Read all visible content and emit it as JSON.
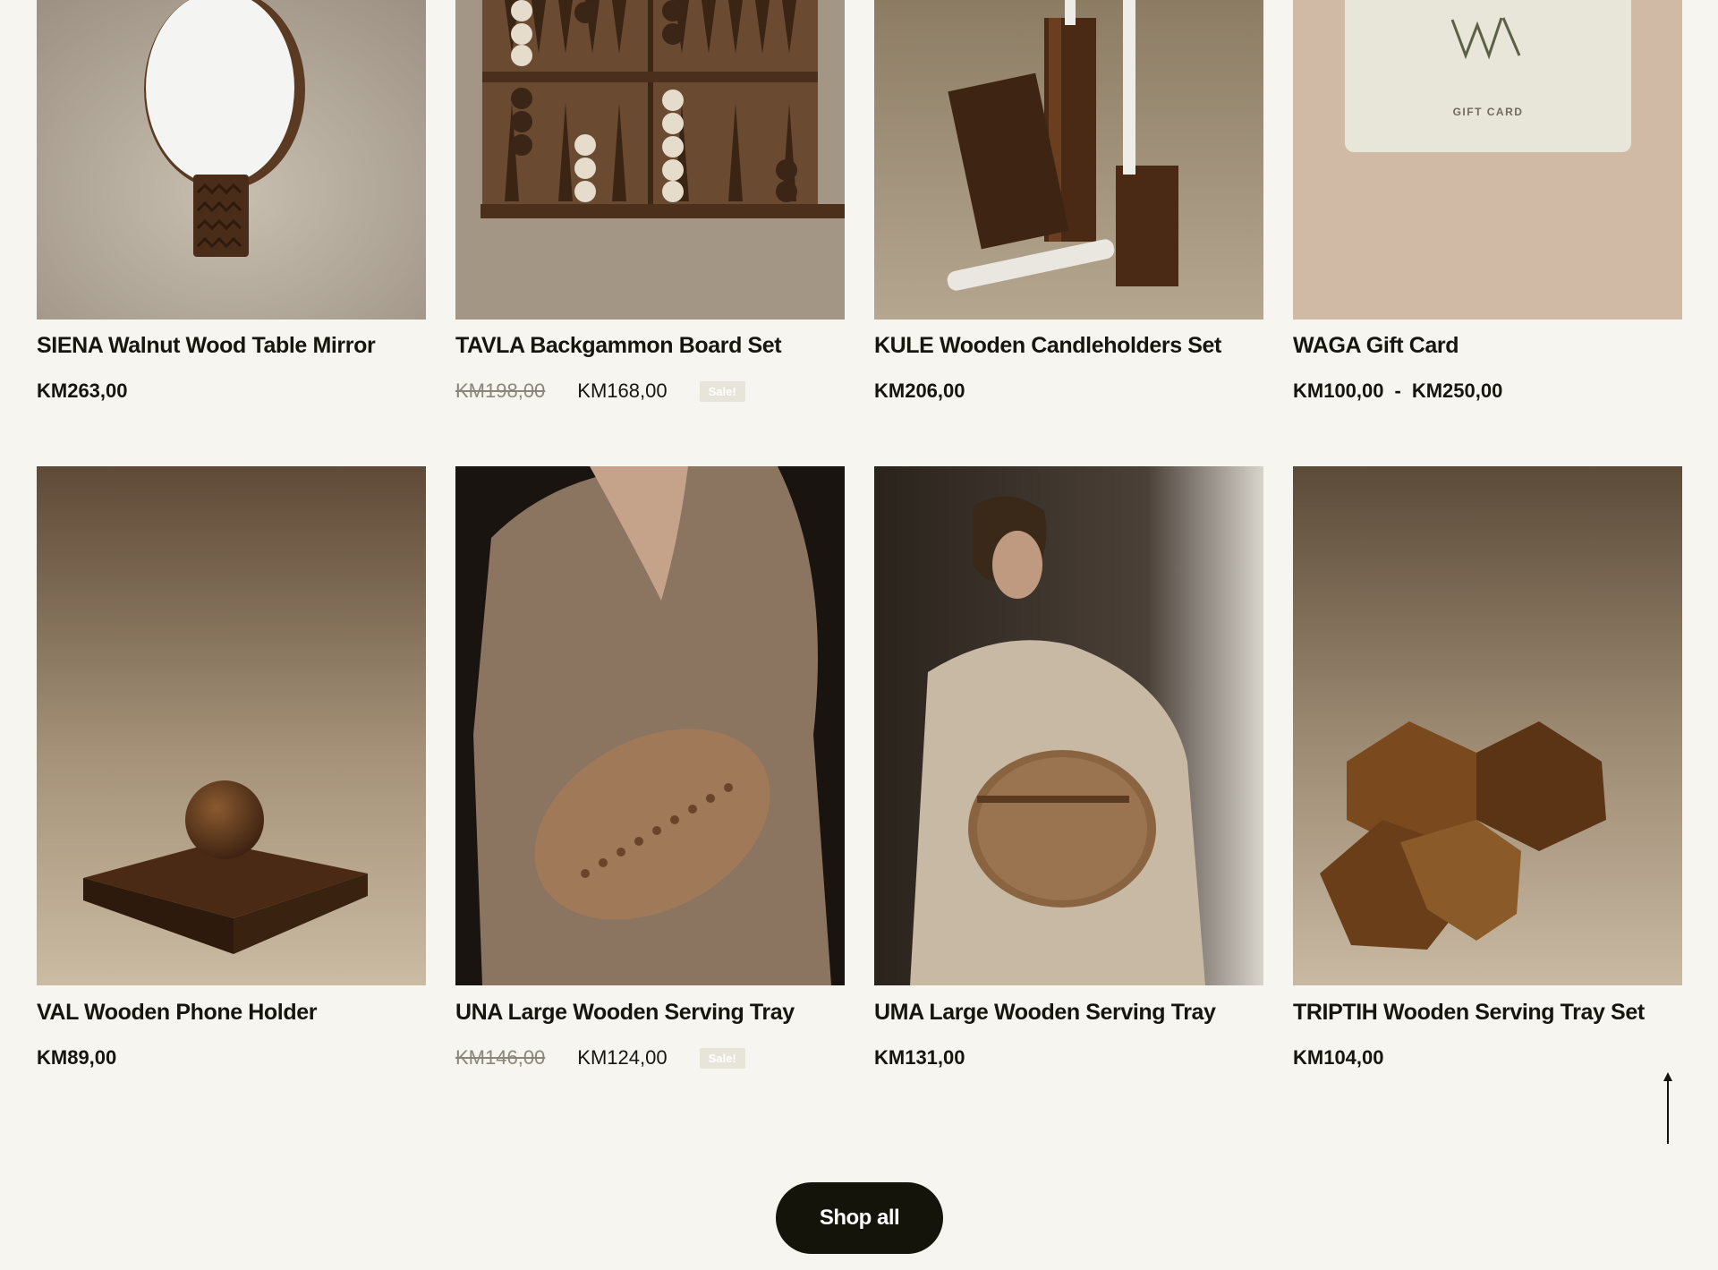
{
  "products_row1": [
    {
      "title": "SIENA Walnut Wood Table Mirror",
      "price": "KM263,00"
    },
    {
      "title": "TAVLA Backgammon Board Set",
      "old_price": "KM198,00",
      "price": "KM168,00",
      "badge": "Sale!"
    },
    {
      "title": "KULE Wooden Candleholders Set",
      "price": "KM206,00"
    },
    {
      "title": "WAGA Gift Card",
      "price_min": "KM100,00",
      "separator": "-",
      "price_max": "KM250,00",
      "card_label": "GIFT CARD"
    }
  ],
  "products_row2": [
    {
      "title": "VAL Wooden Phone Holder",
      "price": "KM89,00"
    },
    {
      "title": "UNA Large Wooden Serving Tray",
      "old_price": "KM146,00",
      "price": "KM124,00",
      "badge": "Sale!"
    },
    {
      "title": "UMA Large Wooden Serving Tray",
      "price": "KM131,00"
    },
    {
      "title": "TRIPTIH Wooden Serving Tray Set",
      "price": "KM104,00"
    }
  ],
  "shop_all": {
    "label": "Shop all"
  },
  "icons": {
    "scroll_top": "arrow-up-icon"
  },
  "colors": {
    "background": "#f6f5f0",
    "button": "#14140a",
    "badge": "#e7e4da",
    "strike": "#8b8679"
  }
}
